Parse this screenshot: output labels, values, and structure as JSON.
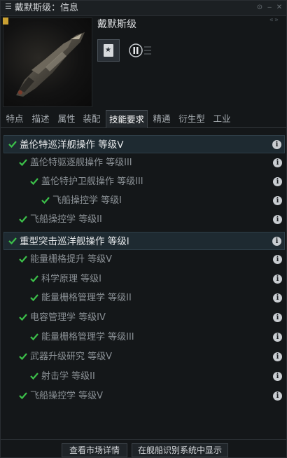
{
  "window": {
    "title": "戴默斯级：信息",
    "menu_icon": "hamburger-icon"
  },
  "header": {
    "ship_name": "戴默斯级",
    "collapse": "«»"
  },
  "tabs": [
    {
      "label": "特点"
    },
    {
      "label": "描述"
    },
    {
      "label": "属性"
    },
    {
      "label": "装配"
    },
    {
      "label": "技能要求"
    },
    {
      "label": "精通"
    },
    {
      "label": "衍生型"
    },
    {
      "label": "工业"
    }
  ],
  "active_tab": "技能要求",
  "skills": [
    {
      "label": "盖伦特巡洋舰操作 等级V"
    },
    {
      "label": "盖伦特驱逐舰操作 等级III"
    },
    {
      "label": "盖伦特护卫舰操作 等级III"
    },
    {
      "label": "飞船操控学 等级I"
    },
    {
      "label": "飞船操控学 等级II"
    },
    {
      "label": "重型突击巡洋舰操作 等级I"
    },
    {
      "label": "能量栅格提升 等级V"
    },
    {
      "label": "科学原理 等级I"
    },
    {
      "label": "能量栅格管理学 等级II"
    },
    {
      "label": "电容管理学 等级IV"
    },
    {
      "label": "能量栅格管理学 等级III"
    },
    {
      "label": "武器升级研究 等级V"
    },
    {
      "label": "射击学 等级II"
    },
    {
      "label": "飞船操控学 等级V"
    }
  ],
  "footer": {
    "market_button": "查看市场详情",
    "show_in_isis_button": "在舰船识别系统中显示"
  },
  "colors": {
    "check_green": "#3cc14a",
    "top_row_bg": "#1e2a31"
  }
}
